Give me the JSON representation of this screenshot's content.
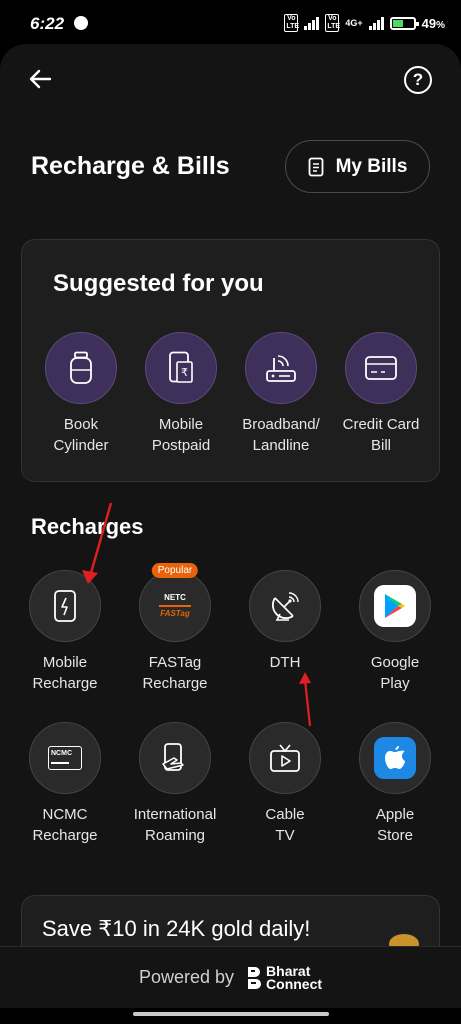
{
  "status": {
    "time": "6:22",
    "battery": "49",
    "network": "4G+"
  },
  "header": {
    "title": "Recharge & Bills",
    "my_bills": "My Bills"
  },
  "suggested": {
    "title": "Suggested for you",
    "items": [
      {
        "line1": "Book",
        "line2": "Cylinder",
        "icon": "gas-cylinder-icon"
      },
      {
        "line1": "Mobile",
        "line2": "Postpaid",
        "icon": "postpaid-bill-icon"
      },
      {
        "line1": "Broadband/",
        "line2": "Landline",
        "icon": "router-icon"
      },
      {
        "line1": "Credit Card",
        "line2": "Bill",
        "icon": "credit-card-icon"
      }
    ]
  },
  "recharges": {
    "title": "Recharges",
    "items": [
      {
        "line1": "Mobile",
        "line2": "Recharge",
        "icon": "mobile-bolt-icon"
      },
      {
        "line1": "FASTag",
        "line2": "Recharge",
        "icon": "fastag-icon",
        "badge": "Popular",
        "logo_top": "NETC",
        "logo_bottom": "FASTag"
      },
      {
        "line1": "DTH",
        "line2": "",
        "icon": "satellite-dish-icon"
      },
      {
        "line1": "Google",
        "line2": "Play",
        "icon": "google-play-icon"
      },
      {
        "line1": "NCMC",
        "line2": "Recharge",
        "icon": "ncmc-card-icon",
        "card_text": "NCMC"
      },
      {
        "line1": "International",
        "line2": "Roaming",
        "icon": "roaming-plane-icon"
      },
      {
        "line1": "Cable",
        "line2": "TV",
        "icon": "tv-icon"
      },
      {
        "line1": "Apple",
        "line2": "Store",
        "icon": "apple-store-icon"
      }
    ]
  },
  "promo": {
    "text": "Save ₹10 in 24K gold daily!"
  },
  "footer": {
    "powered_by": "Powered by",
    "brand_line1": "Bharat",
    "brand_line2": "Connect"
  }
}
